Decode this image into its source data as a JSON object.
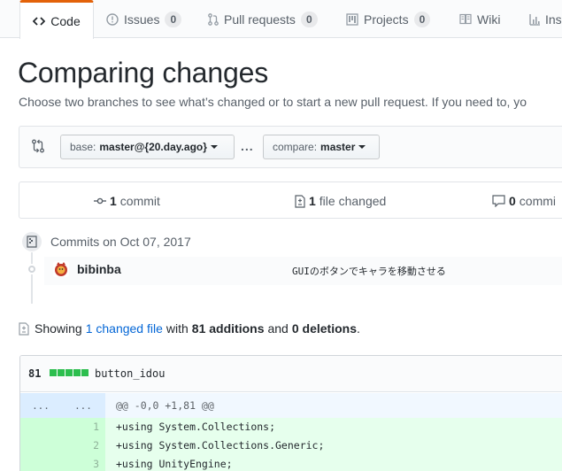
{
  "nav": {
    "tabs": [
      {
        "label": "Code",
        "icon": "code-icon",
        "selected": true
      },
      {
        "label": "Issues",
        "icon": "issue-icon",
        "count": "0"
      },
      {
        "label": "Pull requests",
        "icon": "pull-request-icon",
        "count": "0"
      },
      {
        "label": "Projects",
        "icon": "project-icon",
        "count": "0"
      },
      {
        "label": "Wiki",
        "icon": "book-icon"
      },
      {
        "label": "Ins",
        "icon": "graph-icon"
      }
    ]
  },
  "page": {
    "title": "Comparing changes",
    "subtitle": "Choose two branches to see what’s changed or to start a new pull request. If you need to, yo"
  },
  "range": {
    "base_prefix": "base:",
    "base_ref": "master@{20.day.ago}",
    "separator": "...",
    "compare_prefix": "compare:",
    "compare_ref": "master"
  },
  "summary": {
    "commits_count": "1",
    "commits_label": "commit",
    "files_count": "1",
    "files_label": "file changed",
    "comments_count": "0",
    "comments_label": "commi"
  },
  "commits": {
    "group_title": "Commits on Oct 07, 2017",
    "items": [
      {
        "author": "bibinba",
        "message": "GUIのボタンでキャラを移動させる"
      }
    ]
  },
  "diff_summary": {
    "showing": "Showing",
    "changed_link": "1 changed file",
    "with": "with",
    "additions": "81 additions",
    "and": "and",
    "deletions": "0 deletions",
    "period": "."
  },
  "file": {
    "diffstat": "81",
    "diffstat_blocks": 5,
    "name": "button_idou",
    "hunk_old_gutter": "...",
    "hunk_new_gutter": "...",
    "hunk_header": "@@ -0,0 +1,81 @@",
    "lines": [
      {
        "num": "1",
        "code": "+using System.Collections;"
      },
      {
        "num": "2",
        "code": "+using System.Collections.Generic;"
      },
      {
        "num": "3",
        "code": "+using UnityEngine;"
      }
    ]
  },
  "colors": {
    "accent_tab": "#e36209",
    "link": "#0366d6",
    "addition_bg": "#e6ffed",
    "addition_gutter": "#cdffd8",
    "hunk_bg": "#f1f8ff",
    "diffstat_green": "#2cbe4e"
  }
}
